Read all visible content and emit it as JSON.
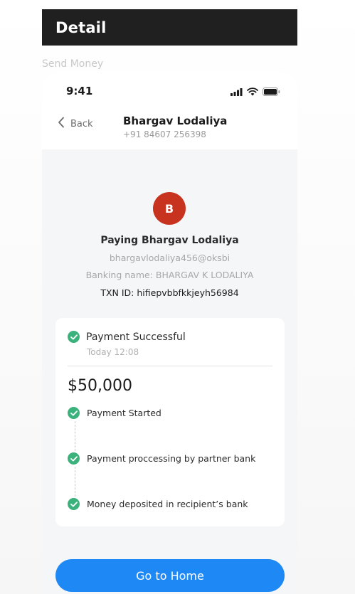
{
  "header": {
    "title": "Detail"
  },
  "section_label": "Send Money",
  "status_bar": {
    "time": "9:41",
    "icons": [
      "signal-icon",
      "wifi-icon",
      "battery-icon"
    ]
  },
  "nav": {
    "back_label": "Back",
    "contact_name": "Bhargav Lodaliya",
    "contact_phone": "+91 84607 256398"
  },
  "recipient": {
    "avatar_letter": "B",
    "avatar_color": "#c8331f",
    "paying_text": "Paying Bhargav Lodaliya",
    "upi_id": "bhargavlodaliya456@oksbi",
    "banking_name": "Banking name: BHARGAV K LODALIYA",
    "txn_id": "TXN ID: hifiepvbbfkkjeyh56984"
  },
  "payment": {
    "status": "Payment Successful",
    "status_time": "Today 12:08",
    "amount": "$50,000",
    "success_color": "#3bb17b",
    "steps": [
      {
        "label": "Payment Started"
      },
      {
        "label": "Payment proccessing by partner bank"
      },
      {
        "label": "Money deposited in recipient’s bank"
      }
    ]
  },
  "cta": {
    "label": "Go to Home",
    "color": "#1e88f5"
  }
}
